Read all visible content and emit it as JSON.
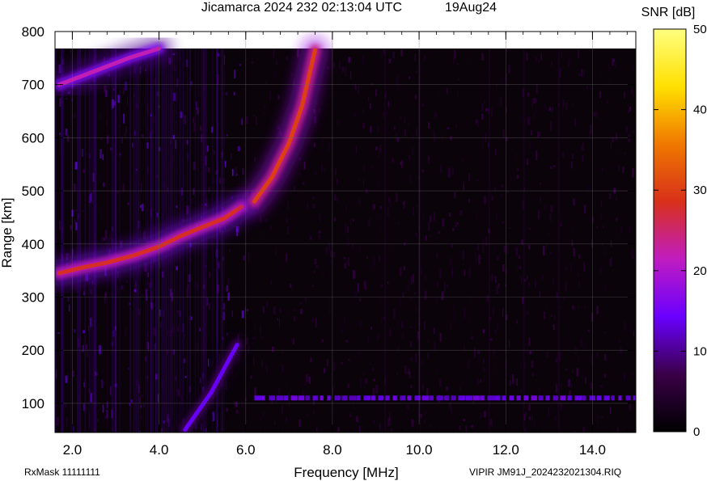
{
  "header": {
    "title": "Jicamarca 2024 232 02:13:04 UTC",
    "date": "19Aug24",
    "colorbar_label": "SNR [dB]"
  },
  "footer": {
    "rxmask": "RxMask 11111111",
    "file": "VIPIR  JM91J_2024232021304.RIQ"
  },
  "chart_data": {
    "type": "heatmap",
    "title": "Jicamarca 2024 232 02:13:04 UTC",
    "xlabel": "Frequency [MHz]",
    "ylabel": "Range [km]",
    "xlim": [
      1.6,
      15.0
    ],
    "ylim": [
      45,
      800
    ],
    "x_ticks": [
      "2.0",
      "4.0",
      "6.0",
      "8.0",
      "10.0",
      "12.0",
      "14.0"
    ],
    "x_tick_values": [
      2,
      4,
      6,
      8,
      10,
      12,
      14
    ],
    "y_ticks": [
      "100",
      "200",
      "300",
      "400",
      "500",
      "600",
      "700",
      "800"
    ],
    "y_tick_values": [
      100,
      200,
      300,
      400,
      500,
      600,
      700,
      800
    ],
    "grid": true,
    "colorbar": {
      "label": "SNR [dB]",
      "range": [
        0,
        50
      ],
      "ticks": [
        "0",
        "10",
        "20",
        "30",
        "40",
        "50"
      ],
      "tick_values": [
        0,
        10,
        20,
        30,
        40,
        50
      ],
      "colors": [
        "#000000",
        "#3a0048",
        "#6a00ff",
        "#c01cc0",
        "#d8301a",
        "#f07800",
        "#ffe000",
        "#ffff80"
      ]
    },
    "traces": [
      {
        "name": "lower-layer trace",
        "snr_db": 28,
        "points": [
          [
            1.7,
            345
          ],
          [
            2.2,
            355
          ],
          [
            2.8,
            365
          ],
          [
            3.4,
            378
          ],
          [
            4.0,
            395
          ],
          [
            4.5,
            415
          ],
          [
            5.0,
            432
          ],
          [
            5.5,
            448
          ],
          [
            5.9,
            470
          ]
        ]
      },
      {
        "name": "upper-layer trace",
        "snr_db": 30,
        "points": [
          [
            6.2,
            480
          ],
          [
            6.6,
            525
          ],
          [
            7.0,
            590
          ],
          [
            7.3,
            660
          ],
          [
            7.6,
            765
          ]
        ]
      },
      {
        "name": "top-left echo",
        "snr_db": 22,
        "points": [
          [
            1.7,
            700
          ],
          [
            2.5,
            725
          ],
          [
            3.3,
            750
          ],
          [
            4.0,
            768
          ]
        ]
      },
      {
        "name": "low-altitude echo",
        "snr_db": 14,
        "points": [
          [
            4.6,
            50
          ],
          [
            5.2,
            120
          ],
          [
            5.8,
            210
          ]
        ]
      }
    ],
    "bands": [
      {
        "name": "110 km band",
        "x": [
          6.2,
          15.0
        ],
        "range_km": 110,
        "snr_db": 12
      }
    ]
  }
}
